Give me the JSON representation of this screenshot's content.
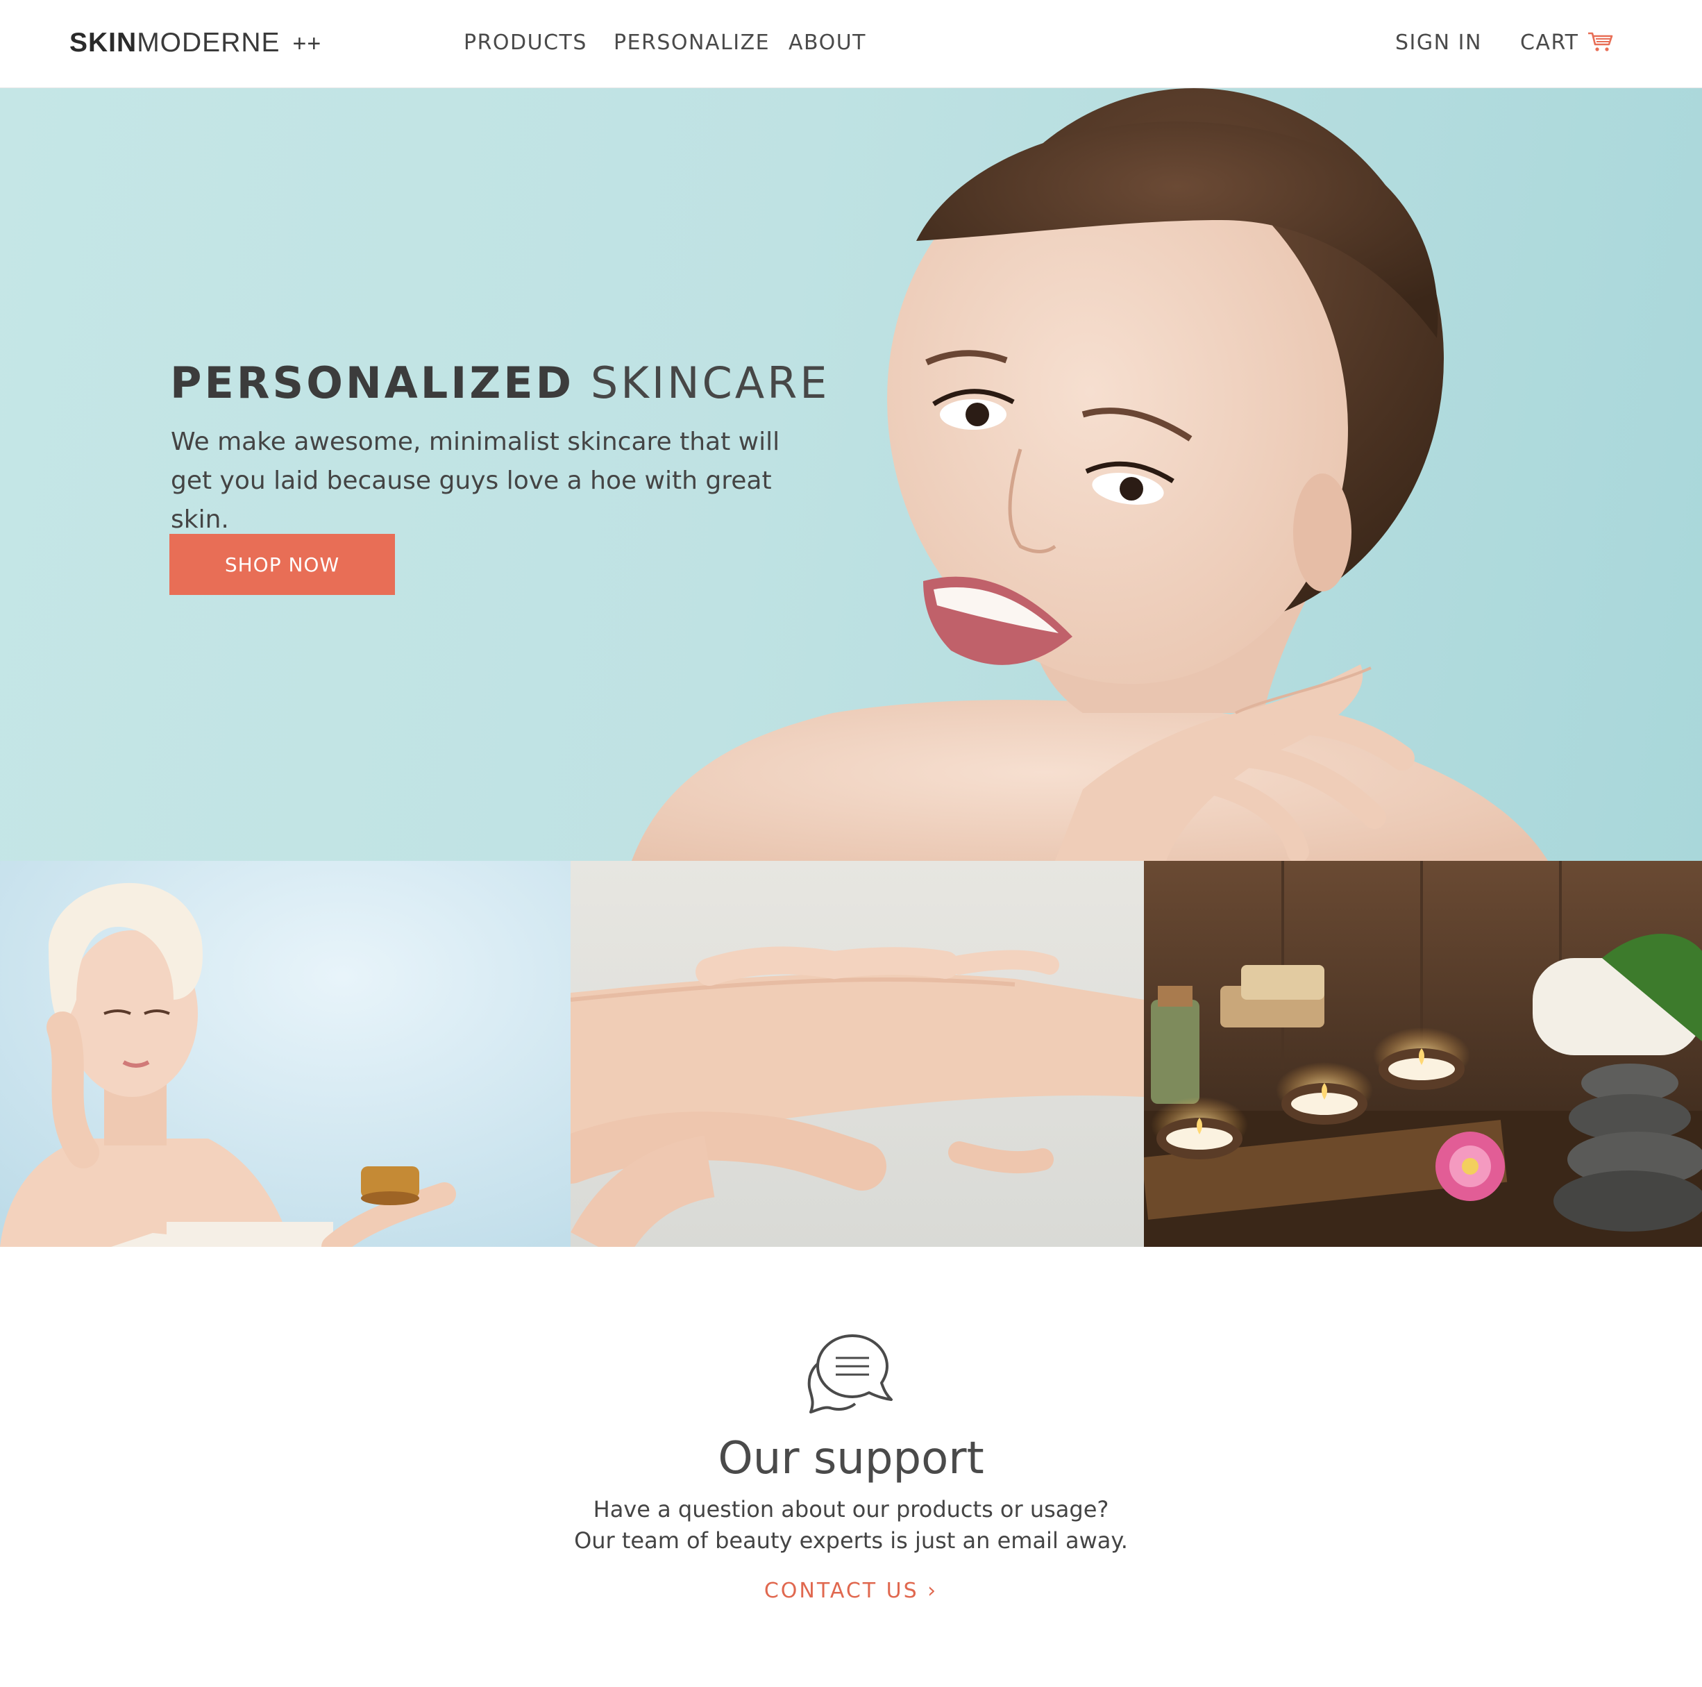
{
  "nav": {
    "logo_bold": "SKIN",
    "logo_light": "MODERNE",
    "logo_suffix": "++",
    "links": [
      "PRODUCTS",
      "PERSONALIZE",
      "ABOUT"
    ],
    "sign_in": "SIGN IN",
    "cart": "CART",
    "cart_icon": "shopping-cart-icon"
  },
  "hero": {
    "title_bold": "PERSONALIZED",
    "title_light": "SKINCARE",
    "copy_line1": "We make awesome, minimalist skincare that will",
    "copy_line2": "get you laid because guys love a hoe with great skin.",
    "cta": "SHOP NOW"
  },
  "support": {
    "icon": "chat-bubbles-icon",
    "title": "Our support",
    "line1": "Have a question about our products or usage?",
    "line2": "Our team of beauty experts is just an email away.",
    "link": "CONTACT US ›"
  },
  "colors": {
    "accent": "#e86e56",
    "hero_bg": "#c0e3e4",
    "text": "#3d3d3d"
  }
}
